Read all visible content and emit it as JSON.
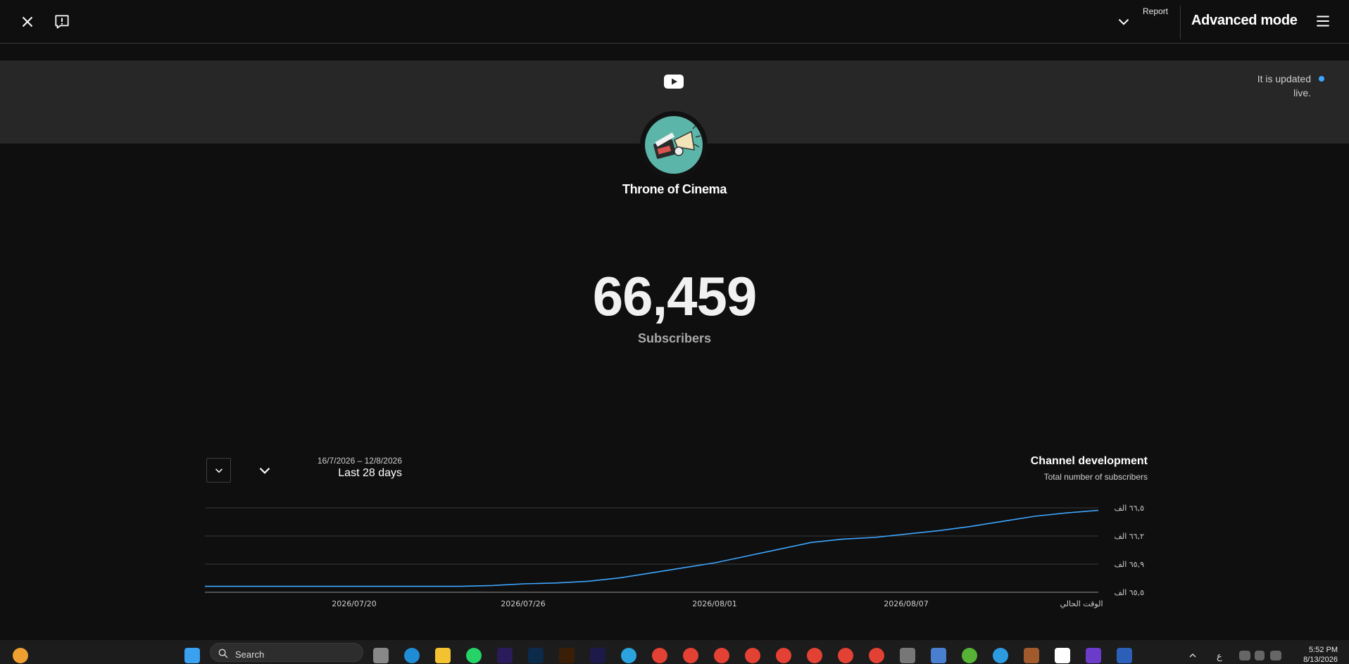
{
  "topbar": {
    "report_label": "Report",
    "mode_label": "Advanced mode"
  },
  "banner": {
    "live_status": "It is updated live.",
    "live_dot_color": "#3ea6ff"
  },
  "channel": {
    "name": "Throne of Cinema",
    "subscriber_count": "66,459",
    "subscriber_label": "Subscribers"
  },
  "chart_header": {
    "date_range": "16/7/2026 – 12/8/2026",
    "period_label": "Last 28 days",
    "title": "Channel development",
    "subtitle": "Total number of subscribers"
  },
  "chart_data": {
    "type": "line",
    "title": "Channel development",
    "subtitle": "Total number of subscribers",
    "x_tick_labels": [
      "2026/07/20",
      "2026/07/26",
      "2026/08/01",
      "2026/08/07",
      "الوقت الحالي"
    ],
    "y_tick_labels": [
      "٦٥,٥ الف",
      "٦٥,٩ الف",
      "٦٦,٢ الف",
      "٦٦,٥ الف"
    ],
    "ylim": [
      65.5,
      66.5
    ],
    "grid": true,
    "line_color": "#3ea6ff",
    "x_relative_days": [
      0,
      2,
      4,
      6,
      7,
      8,
      9,
      10,
      11,
      12,
      13,
      14,
      15,
      16,
      17,
      18,
      19,
      20,
      21,
      22,
      23,
      24,
      25,
      26,
      27,
      28
    ],
    "values": [
      65.57,
      65.57,
      65.57,
      65.57,
      65.57,
      65.57,
      65.58,
      65.6,
      65.61,
      65.63,
      65.67,
      65.73,
      65.79,
      65.85,
      65.93,
      66.01,
      66.09,
      66.13,
      66.15,
      66.19,
      66.23,
      66.28,
      66.34,
      66.4,
      66.44,
      66.47
    ]
  },
  "taskbar": {
    "search_label": "Search",
    "clock_time": "5:52 PM",
    "clock_date": "8/13/2026",
    "lang": "ع"
  }
}
